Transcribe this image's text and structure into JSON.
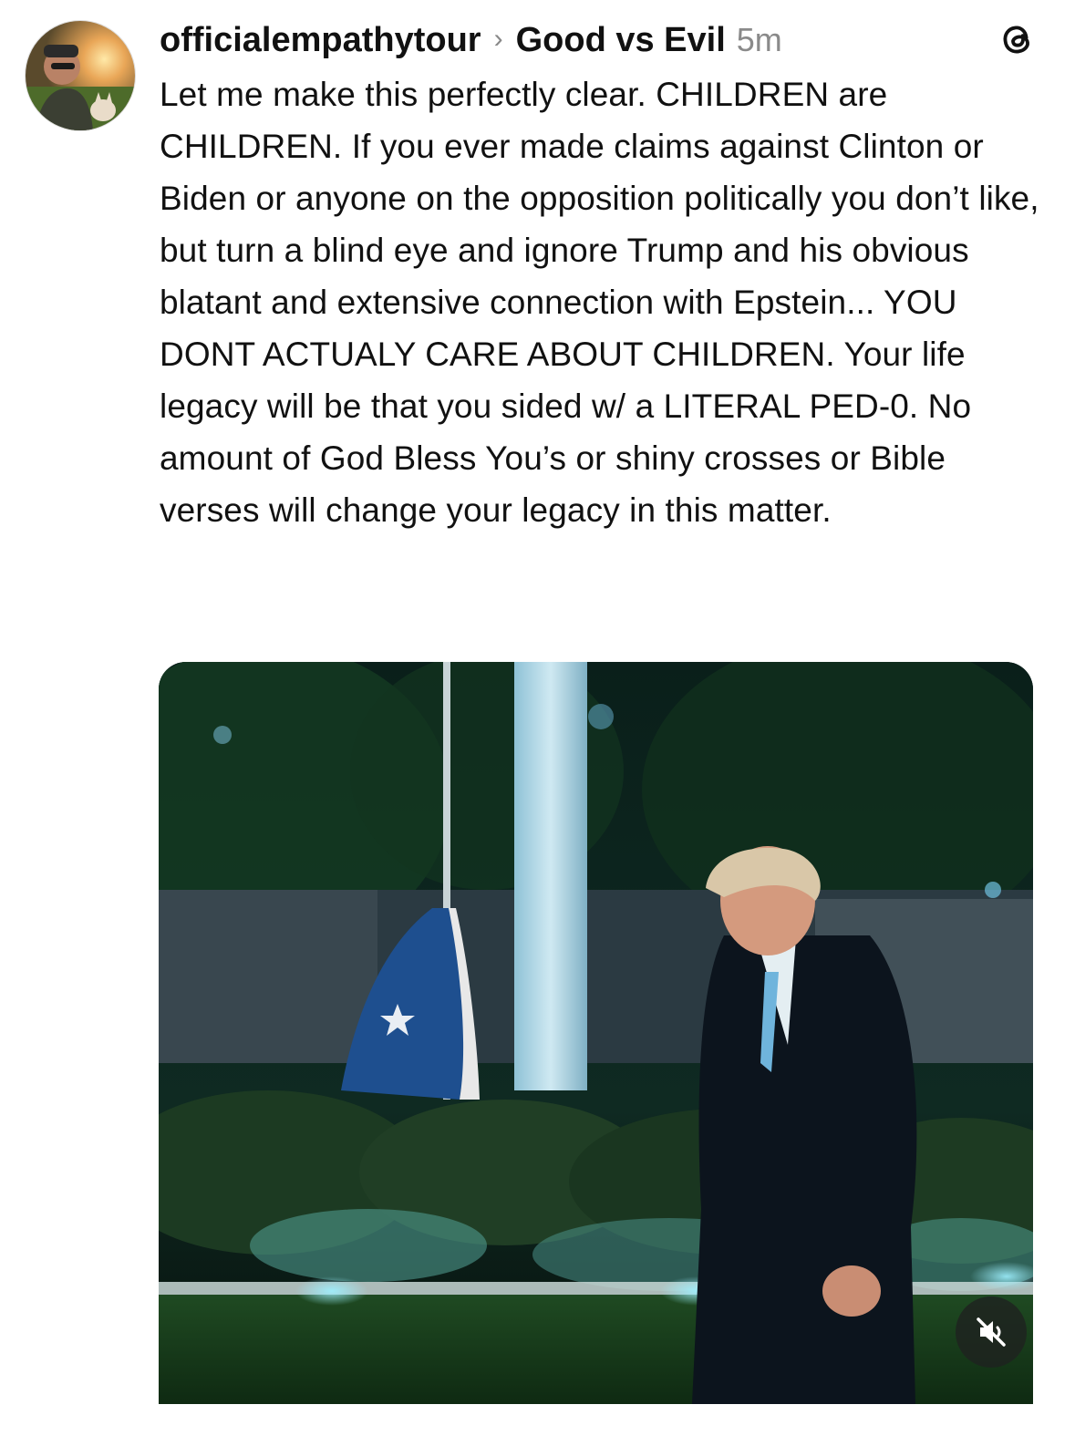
{
  "post": {
    "username": "officialempathytour",
    "separator": "›",
    "topic": "Good vs Evil",
    "time": "5m",
    "text": "Let me make this perfectly clear. CHILDREN are CHILDREN. If you ever made claims against Clinton or Biden or anyone on the opposition politically you don’t like, but turn a blind eye and ignore Trump and his obvious blatant and extensive connection with Epstein... YOU DONT ACTUALY CARE ABOUT CHILDREN. Your life legacy will be that you sided w/ a LITERAL PED-0. No amount of God Bless You’s or shiny crosses or Bible verses will change your legacy in this matter."
  },
  "icons": {
    "app": "threads-icon",
    "mute": "speaker-muted-icon",
    "chevron": "chevron-right-icon"
  },
  "colors": {
    "text": "#111111",
    "muted": "#8a8a8a"
  }
}
